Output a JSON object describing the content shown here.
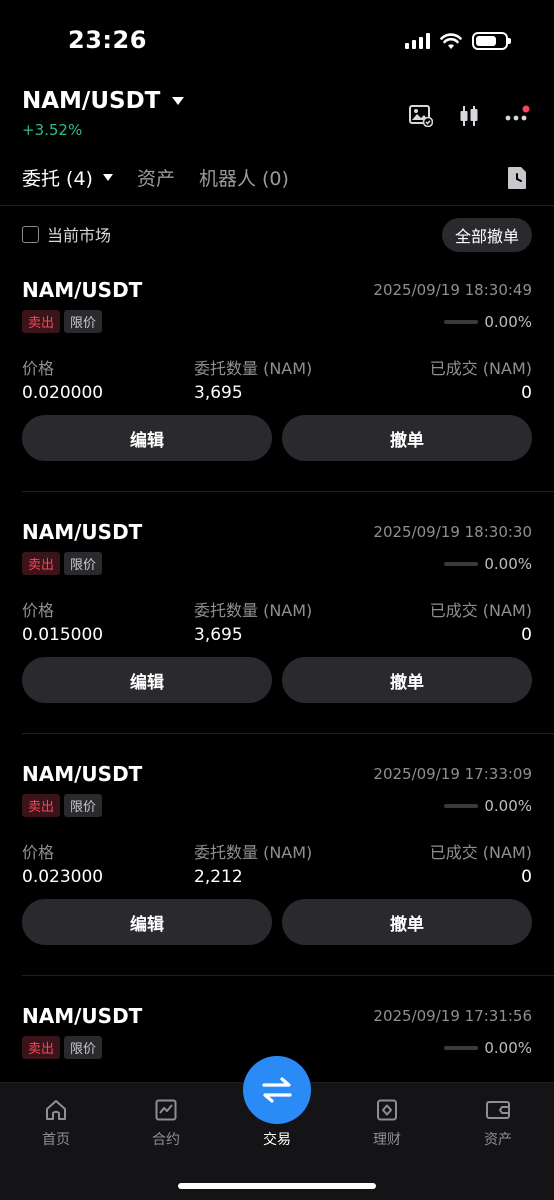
{
  "status_bar": {
    "time": "23:26"
  },
  "header": {
    "pair": "NAM/USDT",
    "change": "+3.52%",
    "change_color": "#2ebd85"
  },
  "tabs": [
    {
      "label": "委托 (4)",
      "active": true
    },
    {
      "label": "资产",
      "active": false
    },
    {
      "label": "机器人 (0)",
      "active": false
    }
  ],
  "filter": {
    "current_market_label": "当前市场",
    "cancel_all_label": "全部撤单"
  },
  "columns": {
    "price": "价格",
    "qty": "委托数量 (NAM)",
    "filled": "已成交 (NAM)"
  },
  "buttons": {
    "edit": "编辑",
    "cancel": "撤单"
  },
  "orders": [
    {
      "symbol": "NAM/USDT",
      "time": "2025/09/19 18:30:49",
      "side": "卖出",
      "type": "限价",
      "progress": "0.00%",
      "progress_fraction": 0,
      "price": "0.020000",
      "qty": "3,695",
      "filled": "0"
    },
    {
      "symbol": "NAM/USDT",
      "time": "2025/09/19 18:30:30",
      "side": "卖出",
      "type": "限价",
      "progress": "0.00%",
      "progress_fraction": 0,
      "price": "0.015000",
      "qty": "3,695",
      "filled": "0"
    },
    {
      "symbol": "NAM/USDT",
      "time": "2025/09/19 17:33:09",
      "side": "卖出",
      "type": "限价",
      "progress": "0.00%",
      "progress_fraction": 0,
      "price": "0.023000",
      "qty": "2,212",
      "filled": "0"
    },
    {
      "symbol": "NAM/USDT",
      "time": "2025/09/19 17:31:56",
      "side": "卖出",
      "type": "限价",
      "progress": "0.00%",
      "progress_fraction": 0
    }
  ],
  "nav": [
    {
      "label": "首页",
      "icon": "home-icon"
    },
    {
      "label": "合约",
      "icon": "chart-icon"
    },
    {
      "label": "交易",
      "icon": "swap-icon"
    },
    {
      "label": "理财",
      "icon": "finance-icon"
    },
    {
      "label": "资产",
      "icon": "wallet-icon"
    }
  ],
  "colors": {
    "accent": "#2a8af6",
    "sell": "#f6465d",
    "buy": "#2ebd85"
  }
}
